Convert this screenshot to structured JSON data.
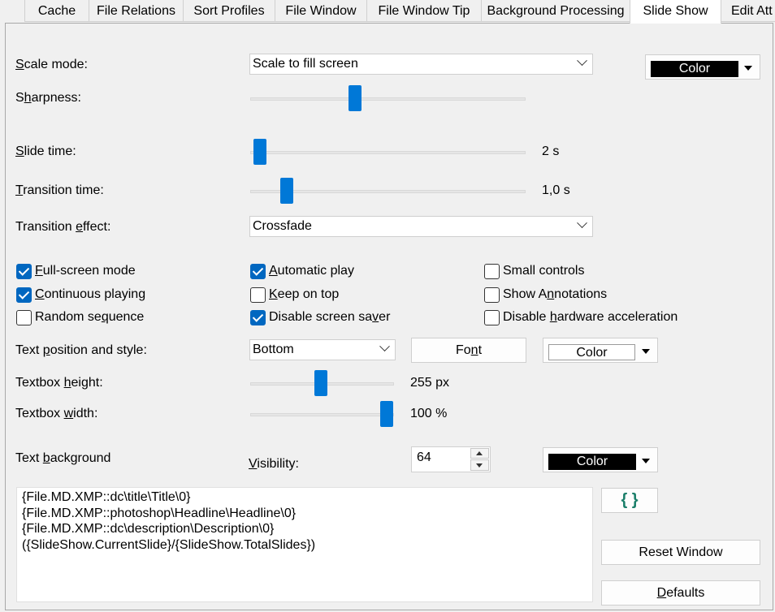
{
  "tabs": [
    "Cache",
    "File Relations",
    "Sort Profiles",
    "File Window",
    "File Window Tip",
    "Background Processing",
    "Slide Show",
    "Edit Att"
  ],
  "active_tab": "Slide Show",
  "scale_mode": {
    "label_pre": "",
    "label_u": "S",
    "label_post": "cale mode:",
    "value": "Scale to fill screen"
  },
  "bg_color_btn": {
    "label": "Color",
    "swatch": "#000000"
  },
  "sharpness": {
    "label_pre": "S",
    "label_u": "h",
    "label_post": "arpness:",
    "value": 0.38
  },
  "slide_time": {
    "label_pre": "",
    "label_u": "S",
    "label_post": "lide time:",
    "value_text": "2 s",
    "value": 0.0
  },
  "transition_time": {
    "label_pre": "",
    "label_u": "T",
    "label_post": "ransition time:",
    "value_text": "1,0 s",
    "value": 0.12
  },
  "transition_effect": {
    "label_pre": "Transition ",
    "label_u": "e",
    "label_post": "ffect:",
    "value": "Crossfade"
  },
  "checkboxes": {
    "fullscreen": {
      "pre": "",
      "u": "F",
      "post": "ull-screen mode",
      "checked": true
    },
    "continuous": {
      "pre": "",
      "u": "C",
      "post": "ontinuous playing",
      "checked": true
    },
    "random": {
      "pre": "Random se",
      "u": "q",
      "post": "uence",
      "checked": false
    },
    "autoplay": {
      "pre": "",
      "u": "A",
      "post": "utomatic play",
      "checked": true
    },
    "keeptop": {
      "pre": "",
      "u": "K",
      "post": "eep on top",
      "checked": false
    },
    "screensaver": {
      "pre": "Disable screen sa",
      "u": "v",
      "post": "er",
      "checked": true
    },
    "small": {
      "pre": "Small controls",
      "u": "",
      "post": "",
      "checked": false
    },
    "annotations": {
      "pre": "Show A",
      "u": "n",
      "post": "notations",
      "checked": false
    },
    "hwaccel": {
      "pre": "Disable ",
      "u": "h",
      "post": "ardware acceleration",
      "checked": false
    }
  },
  "text_position": {
    "label_pre": "Text ",
    "label_u": "p",
    "label_post": "osition and style:",
    "value": "Bottom"
  },
  "font_btn": {
    "pre": "Fo",
    "u": "n",
    "post": "t"
  },
  "text_color_btn": {
    "label": "Color",
    "swatch": "#ffffff"
  },
  "textbox_height": {
    "label_pre": "Textbox ",
    "label_u": "h",
    "label_post": "eight:",
    "value_text": "255 px",
    "value": 0.5
  },
  "textbox_width": {
    "label_pre": "Textbox ",
    "label_u": "w",
    "label_post": "idth:",
    "value_text": "100 %",
    "value": 1.0
  },
  "text_background": {
    "label_pre": "Text ",
    "label_u": "b",
    "label_post": "ackground"
  },
  "visibility": {
    "label_pre": "",
    "label_u": "V",
    "label_post": "isibility:",
    "value": "64"
  },
  "textbg_color_btn": {
    "label": "Color",
    "swatch": "#000000"
  },
  "template_text": "{File.MD.XMP::dc\\title\\Title\\0}\n{File.MD.XMP::photoshop\\Headline\\Headline\\0}\n{File.MD.XMP::dc\\description\\Description\\0}\n({SlideShow.CurrentSlide}/{SlideShow.TotalSlides})",
  "braces_btn": "{ }",
  "reset_window_btn": "Reset Window",
  "defaults_btn": {
    "pre": "",
    "u": "D",
    "post": "efaults"
  }
}
